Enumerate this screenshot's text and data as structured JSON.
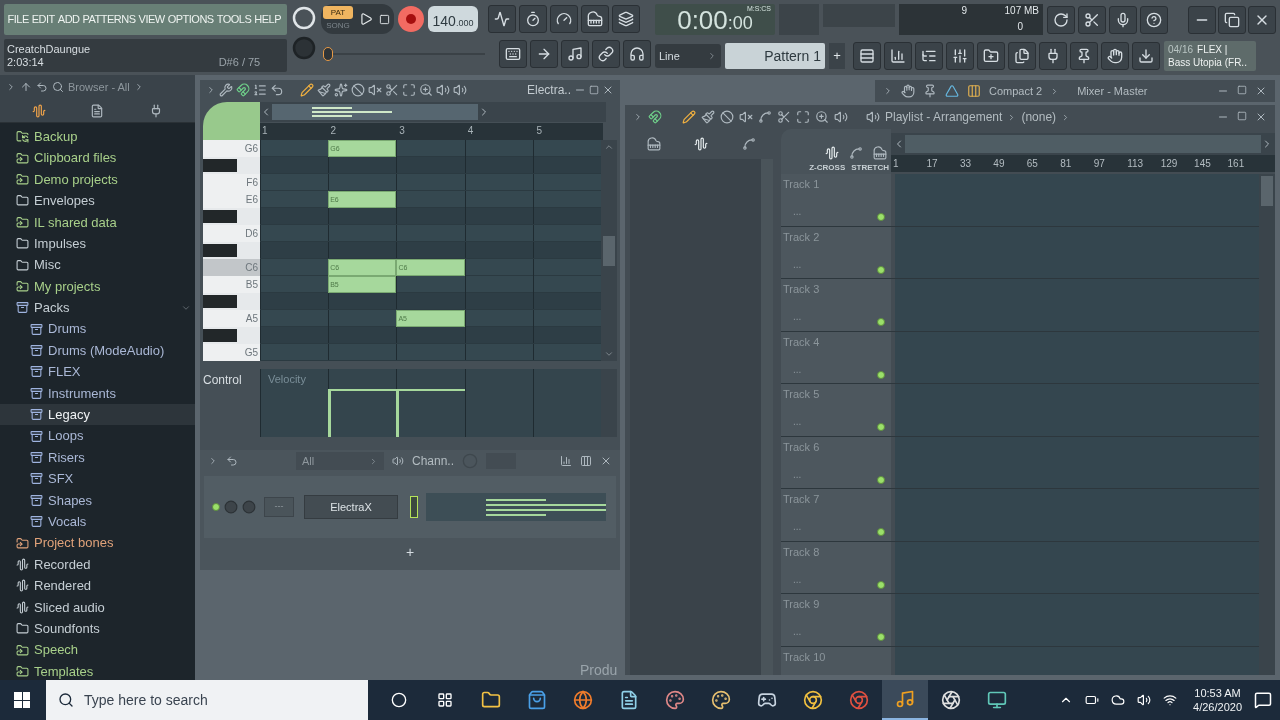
{
  "menu": [
    "FILE",
    "EDIT",
    "ADD",
    "PATTERNS",
    "VIEW",
    "OPTIONS",
    "TOOLS",
    "HELP"
  ],
  "hint": {
    "title": "CreatchDaungue",
    "time": "2:03:14",
    "note": "D#6 / 75"
  },
  "transport": {
    "modes": [
      {
        "label": "PAT",
        "selected": true
      },
      {
        "label": "SONG",
        "selected": false
      }
    ],
    "record_armed": true,
    "tempo": "140",
    "tempo_fraction": ".000"
  },
  "clock": {
    "time_main": "0:00",
    "time_small": ":00",
    "format": "M:S:CS"
  },
  "monitor": {
    "cpu": "9",
    "memory": "107 MB",
    "polyphony": "0"
  },
  "master_pitch": {
    "level": 0
  },
  "snap": "Line",
  "pattern": {
    "name": "Pattern 1",
    "add": "+"
  },
  "news": {
    "counter": "04/16",
    "title": "FLEX |",
    "subtitle": "Bass Utopia (FR.."
  },
  "browser": {
    "title": "Browser - All",
    "items": [
      {
        "label": "Backup",
        "kind": "backup",
        "selected": false
      },
      {
        "label": "Clipboard files",
        "kind": "linked",
        "selected": false
      },
      {
        "label": "Demo projects",
        "kind": "linked",
        "selected": false
      },
      {
        "label": "Envelopes",
        "kind": "folder",
        "selected": false
      },
      {
        "label": "IL shared data",
        "kind": "linked",
        "selected": false
      },
      {
        "label": "Impulses",
        "kind": "folder",
        "selected": false
      },
      {
        "label": "Misc",
        "kind": "folder",
        "selected": false
      },
      {
        "label": "My projects",
        "kind": "linked",
        "selected": false
      },
      {
        "label": "Packs",
        "kind": "pack",
        "selected": false,
        "expanded": true,
        "children": [
          {
            "label": "Drums",
            "kind": "pack",
            "selected": false
          },
          {
            "label": "Drums (ModeAudio)",
            "kind": "pack",
            "selected": false
          },
          {
            "label": "FLEX",
            "kind": "pack",
            "selected": false
          },
          {
            "label": "Instruments",
            "kind": "pack",
            "selected": false
          },
          {
            "label": "Legacy",
            "kind": "pack",
            "selected": true
          },
          {
            "label": "Loops",
            "kind": "pack",
            "selected": false
          },
          {
            "label": "Risers",
            "kind": "pack",
            "selected": false
          },
          {
            "label": "SFX",
            "kind": "pack",
            "selected": false
          },
          {
            "label": "Shapes",
            "kind": "pack",
            "selected": false
          },
          {
            "label": "Vocals",
            "kind": "pack",
            "selected": false
          }
        ]
      },
      {
        "label": "Project bones",
        "kind": "template",
        "selected": false
      },
      {
        "label": "Recorded",
        "kind": "audio",
        "selected": false
      },
      {
        "label": "Rendered",
        "kind": "audio",
        "selected": false
      },
      {
        "label": "Sliced audio",
        "kind": "audio",
        "selected": false
      },
      {
        "label": "Soundfonts",
        "kind": "folder",
        "selected": false
      },
      {
        "label": "Speech",
        "kind": "linked",
        "selected": false
      },
      {
        "label": "Templates",
        "kind": "linked",
        "selected": false
      }
    ]
  },
  "piano_roll": {
    "title": "Electra..",
    "bars": [
      "1",
      "2",
      "3",
      "4",
      "5"
    ],
    "rows": [
      {
        "label": "G6",
        "black": false,
        "selected": false,
        "cells": [
          {
            "note": false
          },
          {
            "note": true,
            "label": "G6"
          },
          {
            "note": false
          },
          {
            "note": false
          },
          {
            "note": false
          }
        ]
      },
      {
        "black": true,
        "selected": false,
        "cells": [
          {
            "note": false
          },
          {
            "note": false
          },
          {
            "note": false
          },
          {
            "note": false
          },
          {
            "note": false
          }
        ]
      },
      {
        "label": "F6",
        "black": false,
        "selected": false,
        "cells": [
          {
            "note": false
          },
          {
            "note": false
          },
          {
            "note": false
          },
          {
            "note": false
          },
          {
            "note": false
          }
        ]
      },
      {
        "label": "E6",
        "black": false,
        "selected": false,
        "cells": [
          {
            "note": false
          },
          {
            "note": true,
            "label": "E6"
          },
          {
            "note": false
          },
          {
            "note": false
          },
          {
            "note": false
          }
        ]
      },
      {
        "black": true,
        "selected": false,
        "cells": [
          {
            "note": false
          },
          {
            "note": false
          },
          {
            "note": false
          },
          {
            "note": false
          },
          {
            "note": false
          }
        ]
      },
      {
        "label": "D6",
        "black": false,
        "selected": false,
        "cells": [
          {
            "note": false
          },
          {
            "note": false
          },
          {
            "note": false
          },
          {
            "note": false
          },
          {
            "note": false
          }
        ]
      },
      {
        "black": true,
        "selected": false,
        "cells": [
          {
            "note": false
          },
          {
            "note": false
          },
          {
            "note": false
          },
          {
            "note": false
          },
          {
            "note": false
          }
        ]
      },
      {
        "label": "C6",
        "black": false,
        "selected": true,
        "cells": [
          {
            "note": false
          },
          {
            "note": true,
            "label": "C6"
          },
          {
            "note": true,
            "label": "C6"
          },
          {
            "note": false
          },
          {
            "note": false
          }
        ]
      },
      {
        "label": "B5",
        "black": false,
        "selected": false,
        "cells": [
          {
            "note": false
          },
          {
            "note": true,
            "label": "B5"
          },
          {
            "note": false
          },
          {
            "note": false
          },
          {
            "note": false
          }
        ]
      },
      {
        "black": true,
        "selected": false,
        "cells": [
          {
            "note": false
          },
          {
            "note": false
          },
          {
            "note": false
          },
          {
            "note": false
          },
          {
            "note": false
          }
        ]
      },
      {
        "label": "A5",
        "black": false,
        "selected": false,
        "cells": [
          {
            "note": false
          },
          {
            "note": false
          },
          {
            "note": true,
            "label": "A5"
          },
          {
            "note": false
          },
          {
            "note": false
          }
        ]
      },
      {
        "black": true,
        "selected": false,
        "cells": [
          {
            "note": false
          },
          {
            "note": false
          },
          {
            "note": false
          },
          {
            "note": false
          },
          {
            "note": false
          }
        ]
      },
      {
        "label": "G5",
        "black": false,
        "selected": false,
        "cells": [
          {
            "note": false
          },
          {
            "note": false
          },
          {
            "note": false
          },
          {
            "note": false
          },
          {
            "note": false
          }
        ]
      }
    ],
    "control": {
      "label": "Control",
      "lane": "Velocity"
    }
  },
  "channel_rack": {
    "filter": "All",
    "title": "Chann..",
    "channels": [
      {
        "name": "ElectraX",
        "number": "---",
        "on": true
      }
    ],
    "add": "+"
  },
  "mixer": {
    "preset": "Compact 2",
    "title": "Mixer - Master"
  },
  "playlist": {
    "title": "Playlist - Arrangement",
    "pattern": "(none)",
    "options": [
      "Z-CROSS",
      "STRETCH"
    ],
    "ruler": [
      "1",
      "17",
      "33",
      "49",
      "65",
      "81",
      "97",
      "113",
      "129",
      "145",
      "161"
    ],
    "tracks": [
      {
        "name": "Track 1",
        "sub": "...",
        "on": true
      },
      {
        "name": "Track 2",
        "sub": "...",
        "on": true
      },
      {
        "name": "Track 3",
        "sub": "...",
        "on": true
      },
      {
        "name": "Track 4",
        "sub": "...",
        "on": true
      },
      {
        "name": "Track 5",
        "sub": "...",
        "on": true
      },
      {
        "name": "Track 6",
        "sub": "...",
        "on": true
      },
      {
        "name": "Track 7",
        "sub": "...",
        "on": true
      },
      {
        "name": "Track 8",
        "sub": "...",
        "on": true
      },
      {
        "name": "Track 9",
        "sub": "...",
        "on": true
      },
      {
        "name": "Track 10"
      }
    ]
  },
  "workspace_caption": "Produ",
  "taskbar": {
    "search_placeholder": "Type here to search",
    "time": "10:53 AM",
    "date": "4/26/2020"
  }
}
